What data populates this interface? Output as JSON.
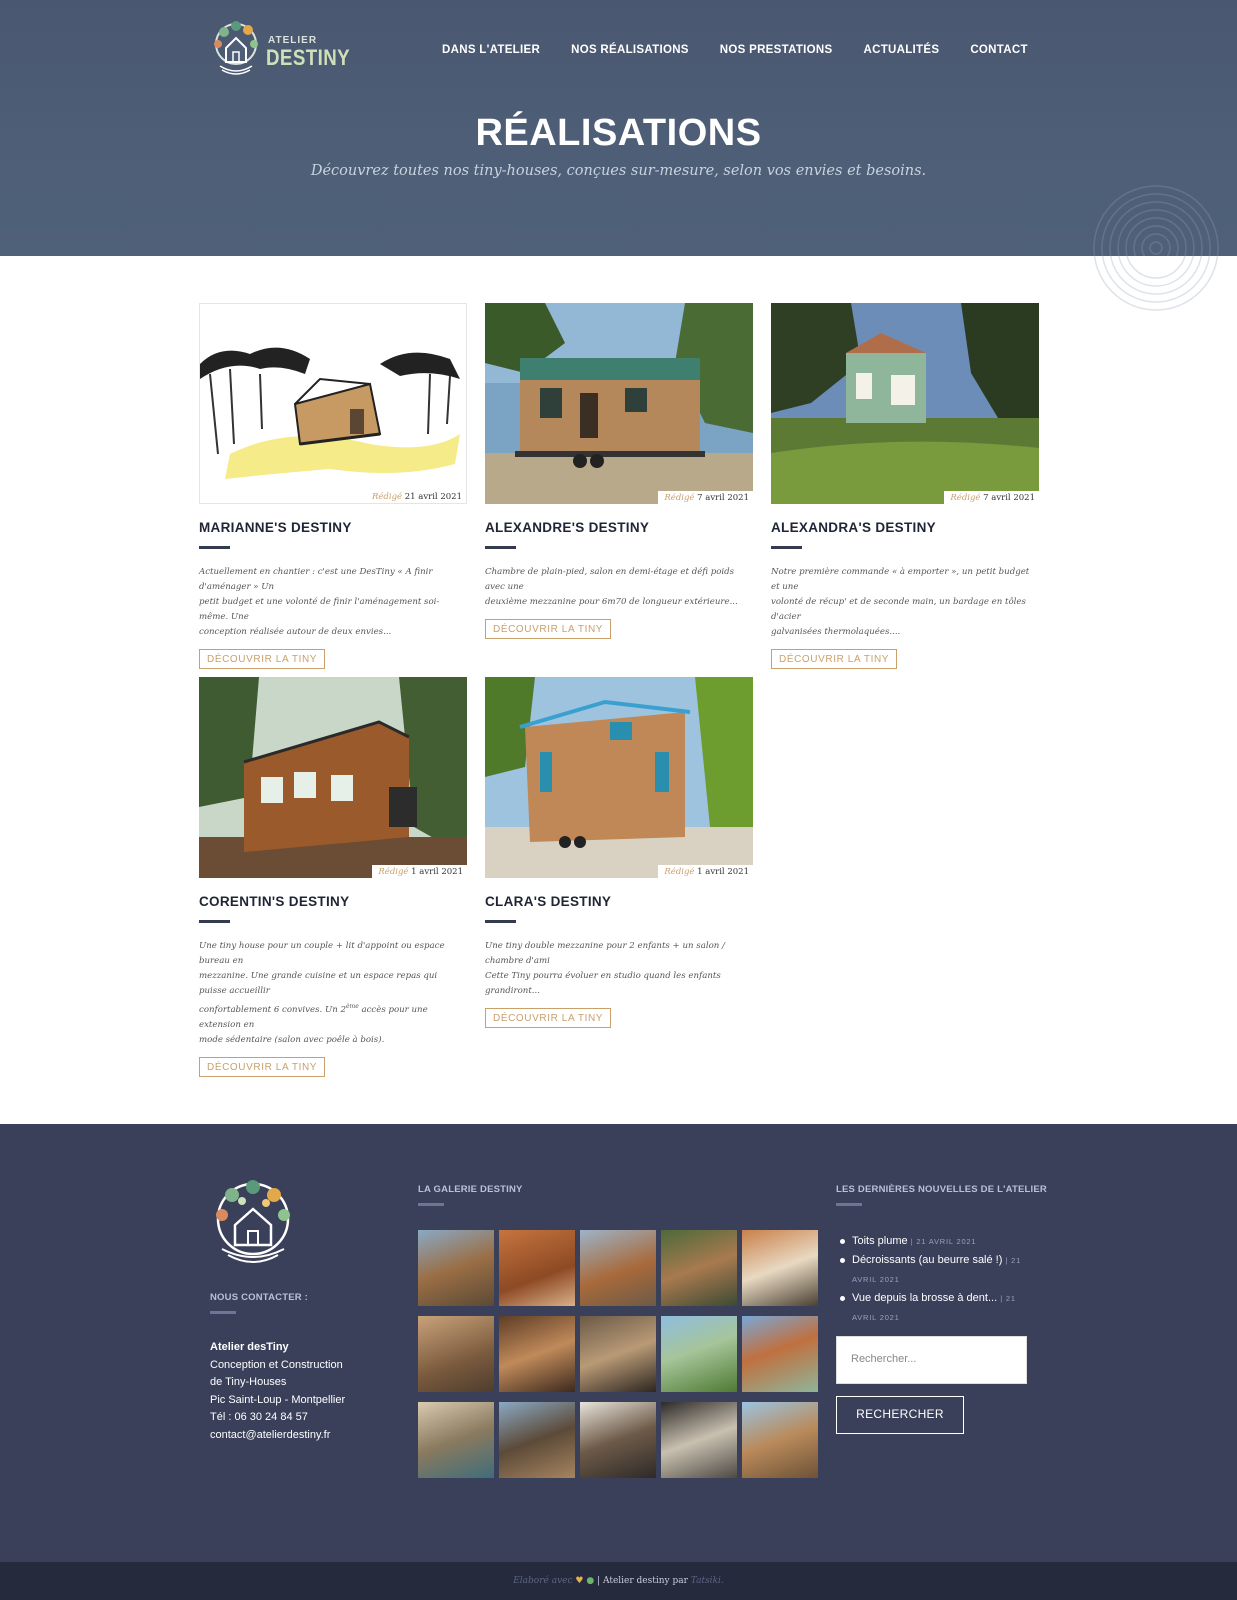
{
  "header": {
    "logo_small": "ATELIER",
    "logo_big": "DESTINY",
    "nav": [
      "DANS L'ATELIER",
      "NOS RÉALISATIONS",
      "NOS PRESTATIONS",
      "ACTUALITÉS",
      "CONTACT"
    ],
    "title": "RÉALISATIONS",
    "subtitle": "Découvrez toutes nos tiny-houses, conçues sur-mesure, selon vos envies et besoins."
  },
  "cards": [
    {
      "title": "MARIANNE'S DESTINY",
      "date_prefix": "Rédigé",
      "date": "21 avril 2021",
      "excerpt": [
        "Actuellement en chantier : c'est une DesTiny « A finir d'aménager » Un",
        "petit budget et une volonté de finir l'aménagement soi-même. Une",
        "conception réalisée autour de deux envies..."
      ],
      "button": "DÉCOUVRIR LA TINY"
    },
    {
      "title": "ALEXANDRE'S DESTINY",
      "date_prefix": "Rédigé",
      "date": "7 avril 2021",
      "excerpt": [
        "Chambre de plain-pied, salon en demi-étage et défi poids avec une",
        "deuxième mezzanine pour 6m70 de longueur extérieure..."
      ],
      "button": "DÉCOUVRIR LA TINY"
    },
    {
      "title": "ALEXANDRA'S DESTINY",
      "date_prefix": "Rédigé",
      "date": "7 avril 2021",
      "excerpt": [
        "Notre première commande « à emporter », un petit budget et une",
        "volonté de récup' et de seconde main, un bardage en tôles d'acier",
        "galvanisées thermolaquées...."
      ],
      "button": "DÉCOUVRIR LA TINY"
    },
    {
      "title": "CORENTIN'S DESTINY",
      "date_prefix": "Rédigé",
      "date": "1 avril 2021",
      "excerpt": [
        "Une tiny house pour un couple + lit d'appoint ou espace bureau en",
        "mezzanine. Une grande cuisine et un espace repas qui puisse accueillir",
        "confortablement 6 convives. Un 2",
        "ème",
        " accès pour une extension en",
        "mode sédentaire (salon avec poêle à bois)."
      ],
      "button": "DÉCOUVRIR LA TINY"
    },
    {
      "title": "CLARA'S DESTINY",
      "date_prefix": "Rédigé",
      "date": "1 avril 2021",
      "excerpt": [
        "Une tiny double mezzanine pour 2 enfants + un salon / chambre d'ami",
        "Cette Tiny pourra évoluer en studio quand les enfants grandiront..."
      ],
      "button": "DÉCOUVRIR LA TINY"
    }
  ],
  "footer": {
    "contact_heading": "NOUS CONTACTER :",
    "address": [
      "Atelier desTiny",
      "Conception et Construction",
      "de Tiny-Houses",
      "Pic Saint-Loup - Montpellier",
      "Tél : 06 30 24 84 57",
      "contact@atelierdestiny.fr"
    ],
    "gallery_heading": "LA GALERIE DESTINY",
    "news_heading": "LES DERNIÈRES NOUVELLES DE L'ATELIER",
    "news": [
      {
        "title": "Toits plume",
        "date": "21 AVRIL 2021"
      },
      {
        "title": "Décroissants (au beurre salé !)",
        "date": "21 AVRIL 2021"
      },
      {
        "title": "Vue depuis la brosse à dent...",
        "date": "21 AVRIL 2021"
      }
    ],
    "search_placeholder": "Rechercher...",
    "search_button": "RECHERCHER"
  },
  "bottom_bar": {
    "prefix": "Elaboré avec",
    "middle": "| Atelier destiny par",
    "author": "Tatsiki."
  },
  "colors": {
    "hero": "#4d5e76",
    "footer": "#3a3f5a",
    "accent": "#c9a06a",
    "dark": "#1f2535"
  }
}
